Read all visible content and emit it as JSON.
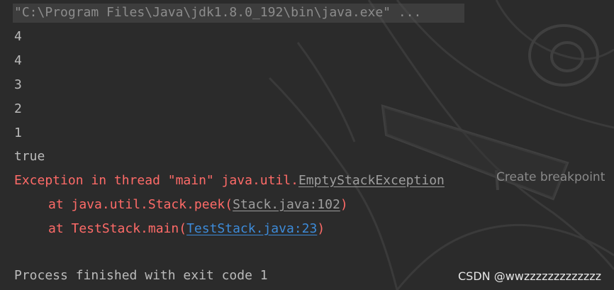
{
  "console": {
    "command": "\"C:\\Program Files\\Java\\jdk1.8.0_192\\bin\\java.exe\" ...",
    "output_lines": [
      "4",
      "4",
      "3",
      "2",
      "1",
      "true"
    ],
    "exception": {
      "prefix": "Exception in thread \"main\" java.util.",
      "class_link": "EmptyStackException",
      "frames": [
        {
          "prefix": "at java.util.Stack.peek(",
          "link": "Stack.java:102",
          "suffix": ")"
        },
        {
          "prefix": "at TestStack.main(",
          "link": "TestStack.java:23",
          "suffix": ")"
        }
      ]
    },
    "breakpoint_hint": "Create breakpoint",
    "exit_message": "Process finished with exit code 1"
  },
  "watermark": "CSDN @wwzzzzzzzzzzzzz",
  "colors": {
    "background": "#2b2b2b",
    "stdout": "#bbbbbb",
    "stderr": "#ff6b68",
    "link": "#3d8bd9"
  }
}
